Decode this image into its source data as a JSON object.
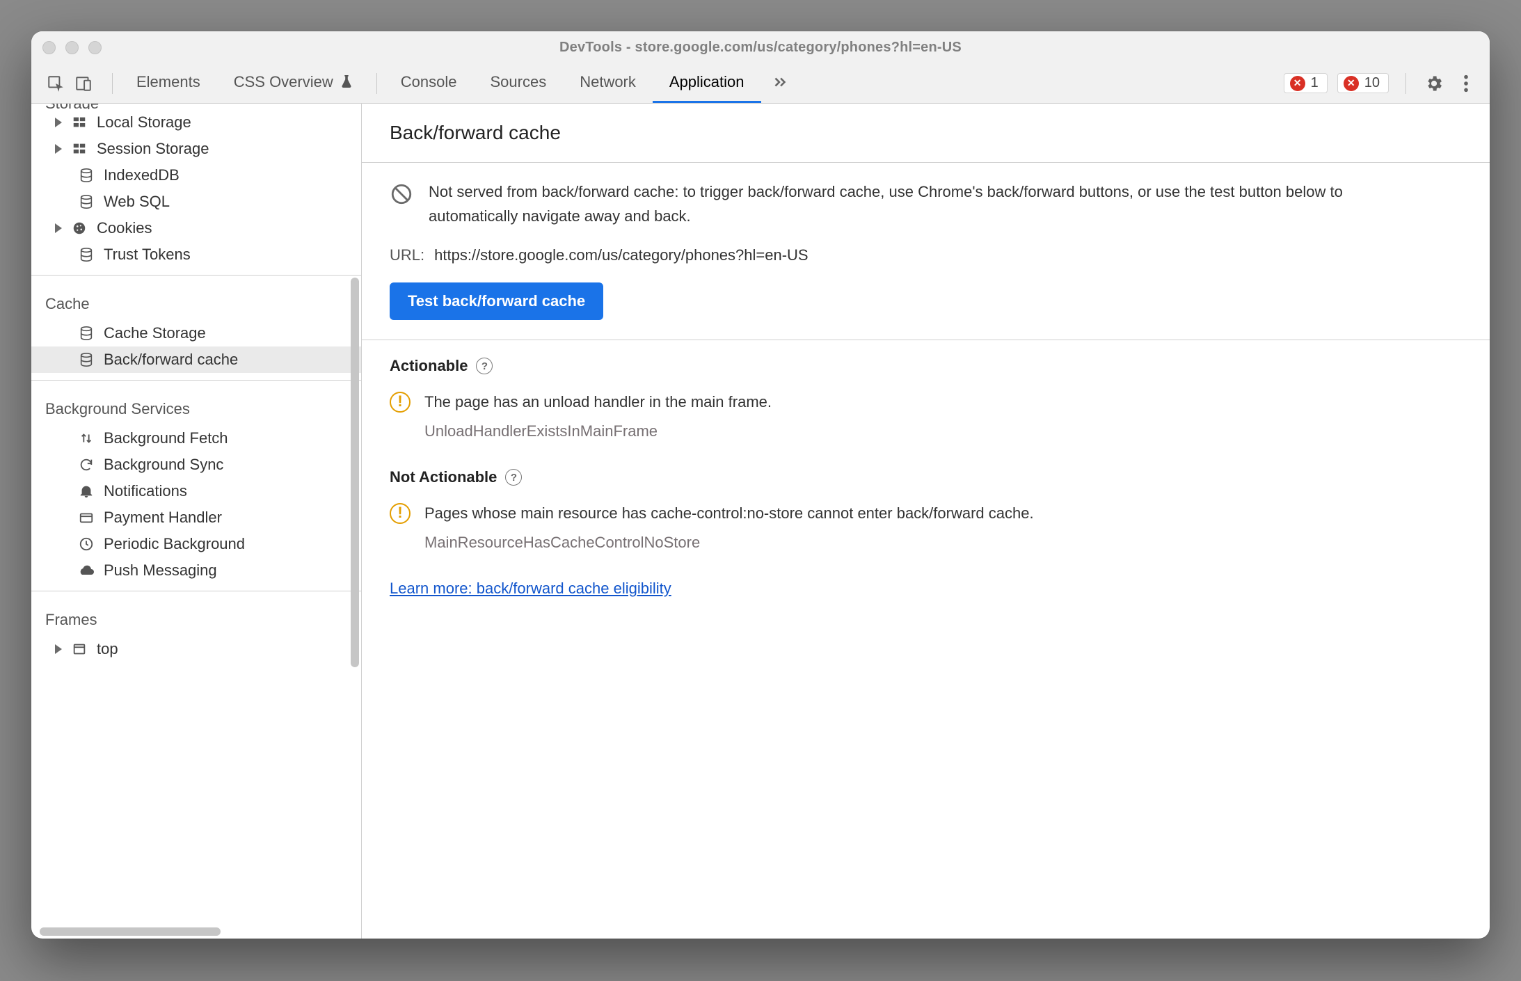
{
  "window": {
    "title": "DevTools - store.google.com/us/category/phones?hl=en-US"
  },
  "tabs": {
    "items": [
      "Elements",
      "CSS Overview",
      "Console",
      "Sources",
      "Network",
      "Application"
    ],
    "active_index": 5,
    "experiment_index": 1
  },
  "toolbar": {
    "error_count_1": "1",
    "error_count_2": "10"
  },
  "sidebar": {
    "storage": {
      "label": "Storage",
      "items": [
        {
          "label": "Local Storage",
          "expandable": true,
          "icon": "db-grid-icon"
        },
        {
          "label": "Session Storage",
          "expandable": true,
          "icon": "db-grid-icon"
        },
        {
          "label": "IndexedDB",
          "expandable": false,
          "icon": "db-stack-icon"
        },
        {
          "label": "Web SQL",
          "expandable": false,
          "icon": "db-stack-icon"
        },
        {
          "label": "Cookies",
          "expandable": true,
          "icon": "cookie-icon"
        },
        {
          "label": "Trust Tokens",
          "expandable": false,
          "icon": "db-stack-icon"
        }
      ]
    },
    "cache": {
      "label": "Cache",
      "items": [
        {
          "label": "Cache Storage",
          "icon": "db-stack-icon"
        },
        {
          "label": "Back/forward cache",
          "icon": "db-stack-icon",
          "selected": true
        }
      ]
    },
    "bg": {
      "label": "Background Services",
      "items": [
        {
          "label": "Background Fetch",
          "icon": "updown-icon"
        },
        {
          "label": "Background Sync",
          "icon": "sync-icon"
        },
        {
          "label": "Notifications",
          "icon": "bell-icon"
        },
        {
          "label": "Payment Handler",
          "icon": "card-icon"
        },
        {
          "label": "Periodic Background",
          "icon": "clock-icon"
        },
        {
          "label": "Push Messaging",
          "icon": "cloud-icon"
        }
      ]
    },
    "frames": {
      "label": "Frames",
      "items": [
        {
          "label": "top",
          "expandable": true,
          "icon": "frame-icon"
        }
      ]
    }
  },
  "main": {
    "heading": "Back/forward cache",
    "notice_text": "Not served from back/forward cache: to trigger back/forward cache, use Chrome's back/forward buttons, or use the test button below to automatically navigate away and back.",
    "url_label": "URL:",
    "url_value": "https://store.google.com/us/category/phones?hl=en-US",
    "test_button": "Test back/forward cache",
    "actionable": {
      "title": "Actionable",
      "issue_text": "The page has an unload handler in the main frame.",
      "issue_code": "UnloadHandlerExistsInMainFrame"
    },
    "not_actionable": {
      "title": "Not Actionable",
      "issue_text": "Pages whose main resource has cache-control:no-store cannot enter back/forward cache.",
      "issue_code": "MainResourceHasCacheControlNoStore"
    },
    "learn_more": "Learn more: back/forward cache eligibility"
  }
}
